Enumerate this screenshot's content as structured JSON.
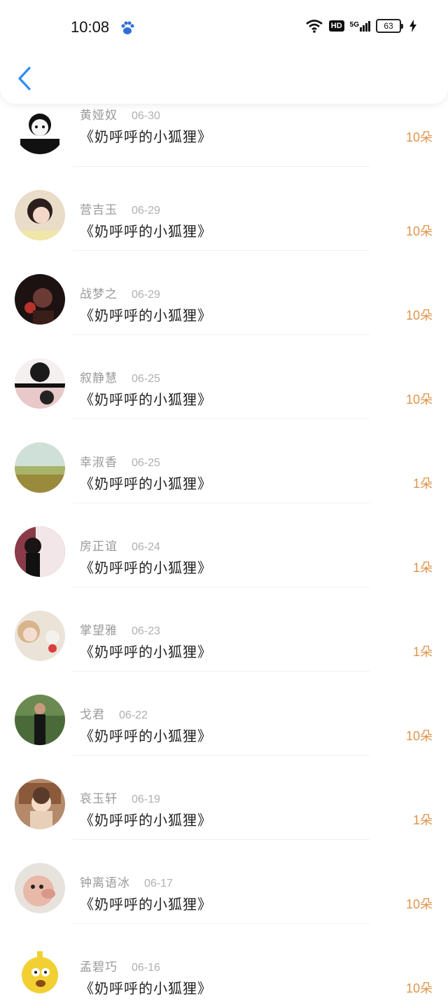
{
  "status_bar": {
    "time": "10:08",
    "network": "5G",
    "hd": "HD",
    "battery": "63"
  },
  "header": {
    "back_icon": "chevron-left-icon",
    "back_color": "#2d8cf0"
  },
  "colors": {
    "amount": "#e0944a",
    "name": "#9a9a9a",
    "date": "#b0b0b0",
    "title": "#222222"
  },
  "items": [
    {
      "name": "黄娅奴",
      "date": "06-30",
      "title": "《奶呼呼的小狐狸》",
      "amount": "10朵"
    },
    {
      "name": "营吉玉",
      "date": "06-29",
      "title": "《奶呼呼的小狐狸》",
      "amount": "10朵"
    },
    {
      "name": "战梦之",
      "date": "06-29",
      "title": "《奶呼呼的小狐狸》",
      "amount": "10朵"
    },
    {
      "name": "叙静慧",
      "date": "06-25",
      "title": "《奶呼呼的小狐狸》",
      "amount": "10朵"
    },
    {
      "name": "幸淑香",
      "date": "06-25",
      "title": "《奶呼呼的小狐狸》",
      "amount": "1朵"
    },
    {
      "name": "房正谊",
      "date": "06-24",
      "title": "《奶呼呼的小狐狸》",
      "amount": "1朵"
    },
    {
      "name": "掌望雅",
      "date": "06-23",
      "title": "《奶呼呼的小狐狸》",
      "amount": "1朵"
    },
    {
      "name": "戈君",
      "date": "06-22",
      "title": "《奶呼呼的小狐狸》",
      "amount": "10朵"
    },
    {
      "name": "哀玉轩",
      "date": "06-19",
      "title": "《奶呼呼的小狐狸》",
      "amount": "1朵"
    },
    {
      "name": "钟离语冰",
      "date": "06-17",
      "title": "《奶呼呼的小狐狸》",
      "amount": "10朵"
    },
    {
      "name": "孟碧巧",
      "date": "06-16",
      "title": "《奶呼呼的小狐狸》",
      "amount": "10朵"
    }
  ]
}
